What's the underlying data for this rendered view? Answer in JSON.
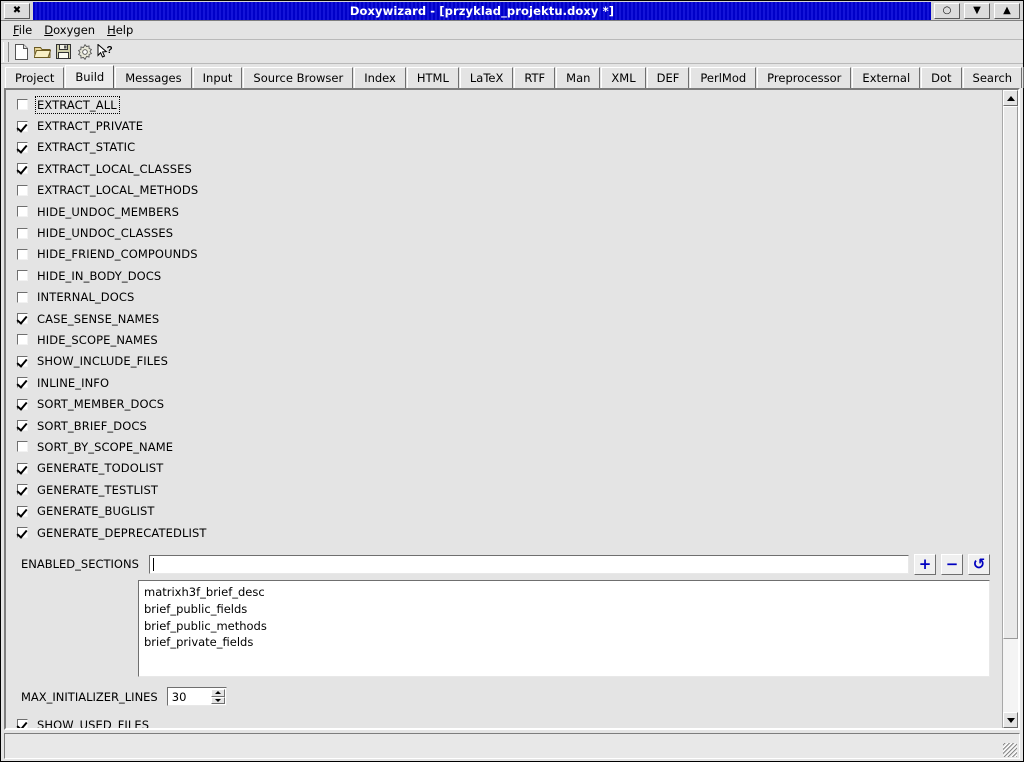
{
  "window": {
    "title": "Doxywizard - [przyklad_projektu.doxy *]",
    "close_glyph": "✖",
    "shade_glyph": "○",
    "minimize_glyph": "▼",
    "maximize_glyph": "▲",
    "titlebar_color": "#0000a8",
    "background_color": "#e4e4e4"
  },
  "menubar": {
    "items": [
      {
        "label": "File",
        "accel": "F"
      },
      {
        "label": "Doxygen",
        "accel": "D"
      },
      {
        "label": "Help",
        "accel": "H"
      }
    ]
  },
  "toolbar": {
    "icons": [
      {
        "name": "new-file-icon",
        "title": "New"
      },
      {
        "name": "open-folder-icon",
        "title": "Open"
      },
      {
        "name": "save-floppy-icon",
        "title": "Save"
      },
      {
        "name": "gear-icon",
        "title": "Run doxygen"
      },
      {
        "name": "help-pointer-icon",
        "title": "What's this?"
      }
    ]
  },
  "tabs": {
    "active": "Build",
    "items": [
      "Project",
      "Build",
      "Messages",
      "Input",
      "Source Browser",
      "Index",
      "HTML",
      "LaTeX",
      "RTF",
      "Man",
      "XML",
      "DEF",
      "PerlMod",
      "Preprocessor",
      "External",
      "Dot",
      "Search"
    ]
  },
  "build_options": [
    {
      "label": "EXTRACT_ALL",
      "checked": false,
      "focused": true
    },
    {
      "label": "EXTRACT_PRIVATE",
      "checked": true,
      "focused": false
    },
    {
      "label": "EXTRACT_STATIC",
      "checked": true,
      "focused": false
    },
    {
      "label": "EXTRACT_LOCAL_CLASSES",
      "checked": true,
      "focused": false
    },
    {
      "label": "EXTRACT_LOCAL_METHODS",
      "checked": false,
      "focused": false
    },
    {
      "label": "HIDE_UNDOC_MEMBERS",
      "checked": false,
      "focused": false
    },
    {
      "label": "HIDE_UNDOC_CLASSES",
      "checked": false,
      "focused": false
    },
    {
      "label": "HIDE_FRIEND_COMPOUNDS",
      "checked": false,
      "focused": false
    },
    {
      "label": "HIDE_IN_BODY_DOCS",
      "checked": false,
      "focused": false
    },
    {
      "label": "INTERNAL_DOCS",
      "checked": false,
      "focused": false
    },
    {
      "label": "CASE_SENSE_NAMES",
      "checked": true,
      "focused": false
    },
    {
      "label": "HIDE_SCOPE_NAMES",
      "checked": false,
      "focused": false
    },
    {
      "label": "SHOW_INCLUDE_FILES",
      "checked": true,
      "focused": false
    },
    {
      "label": "INLINE_INFO",
      "checked": true,
      "focused": false
    },
    {
      "label": "SORT_MEMBER_DOCS",
      "checked": true,
      "focused": false
    },
    {
      "label": "SORT_BRIEF_DOCS",
      "checked": true,
      "focused": false
    },
    {
      "label": "SORT_BY_SCOPE_NAME",
      "checked": false,
      "focused": false
    },
    {
      "label": "GENERATE_TODOLIST",
      "checked": true,
      "focused": false
    },
    {
      "label": "GENERATE_TESTLIST",
      "checked": true,
      "focused": false
    },
    {
      "label": "GENERATE_BUGLIST",
      "checked": true,
      "focused": false
    },
    {
      "label": "GENERATE_DEPRECATEDLIST",
      "checked": true,
      "focused": false
    }
  ],
  "enabled_sections": {
    "label": "ENABLED_SECTIONS",
    "value": "",
    "placeholder": "",
    "add_label": "+",
    "remove_label": "−",
    "reset_label": "↺",
    "button_color": "#0000c0",
    "items": [
      "matrixh3f_brief_desc",
      "brief_public_fields",
      "brief_public_methods",
      "brief_private_fields"
    ]
  },
  "max_initializer_lines": {
    "label": "MAX_INITIALIZER_LINES",
    "value": "30"
  },
  "show_used_files": {
    "label": "SHOW_USED_FILES",
    "checked": true
  },
  "scrollbar": {
    "up_glyph": "▲",
    "down_glyph": "▼"
  },
  "statusbar": {
    "text": ""
  }
}
